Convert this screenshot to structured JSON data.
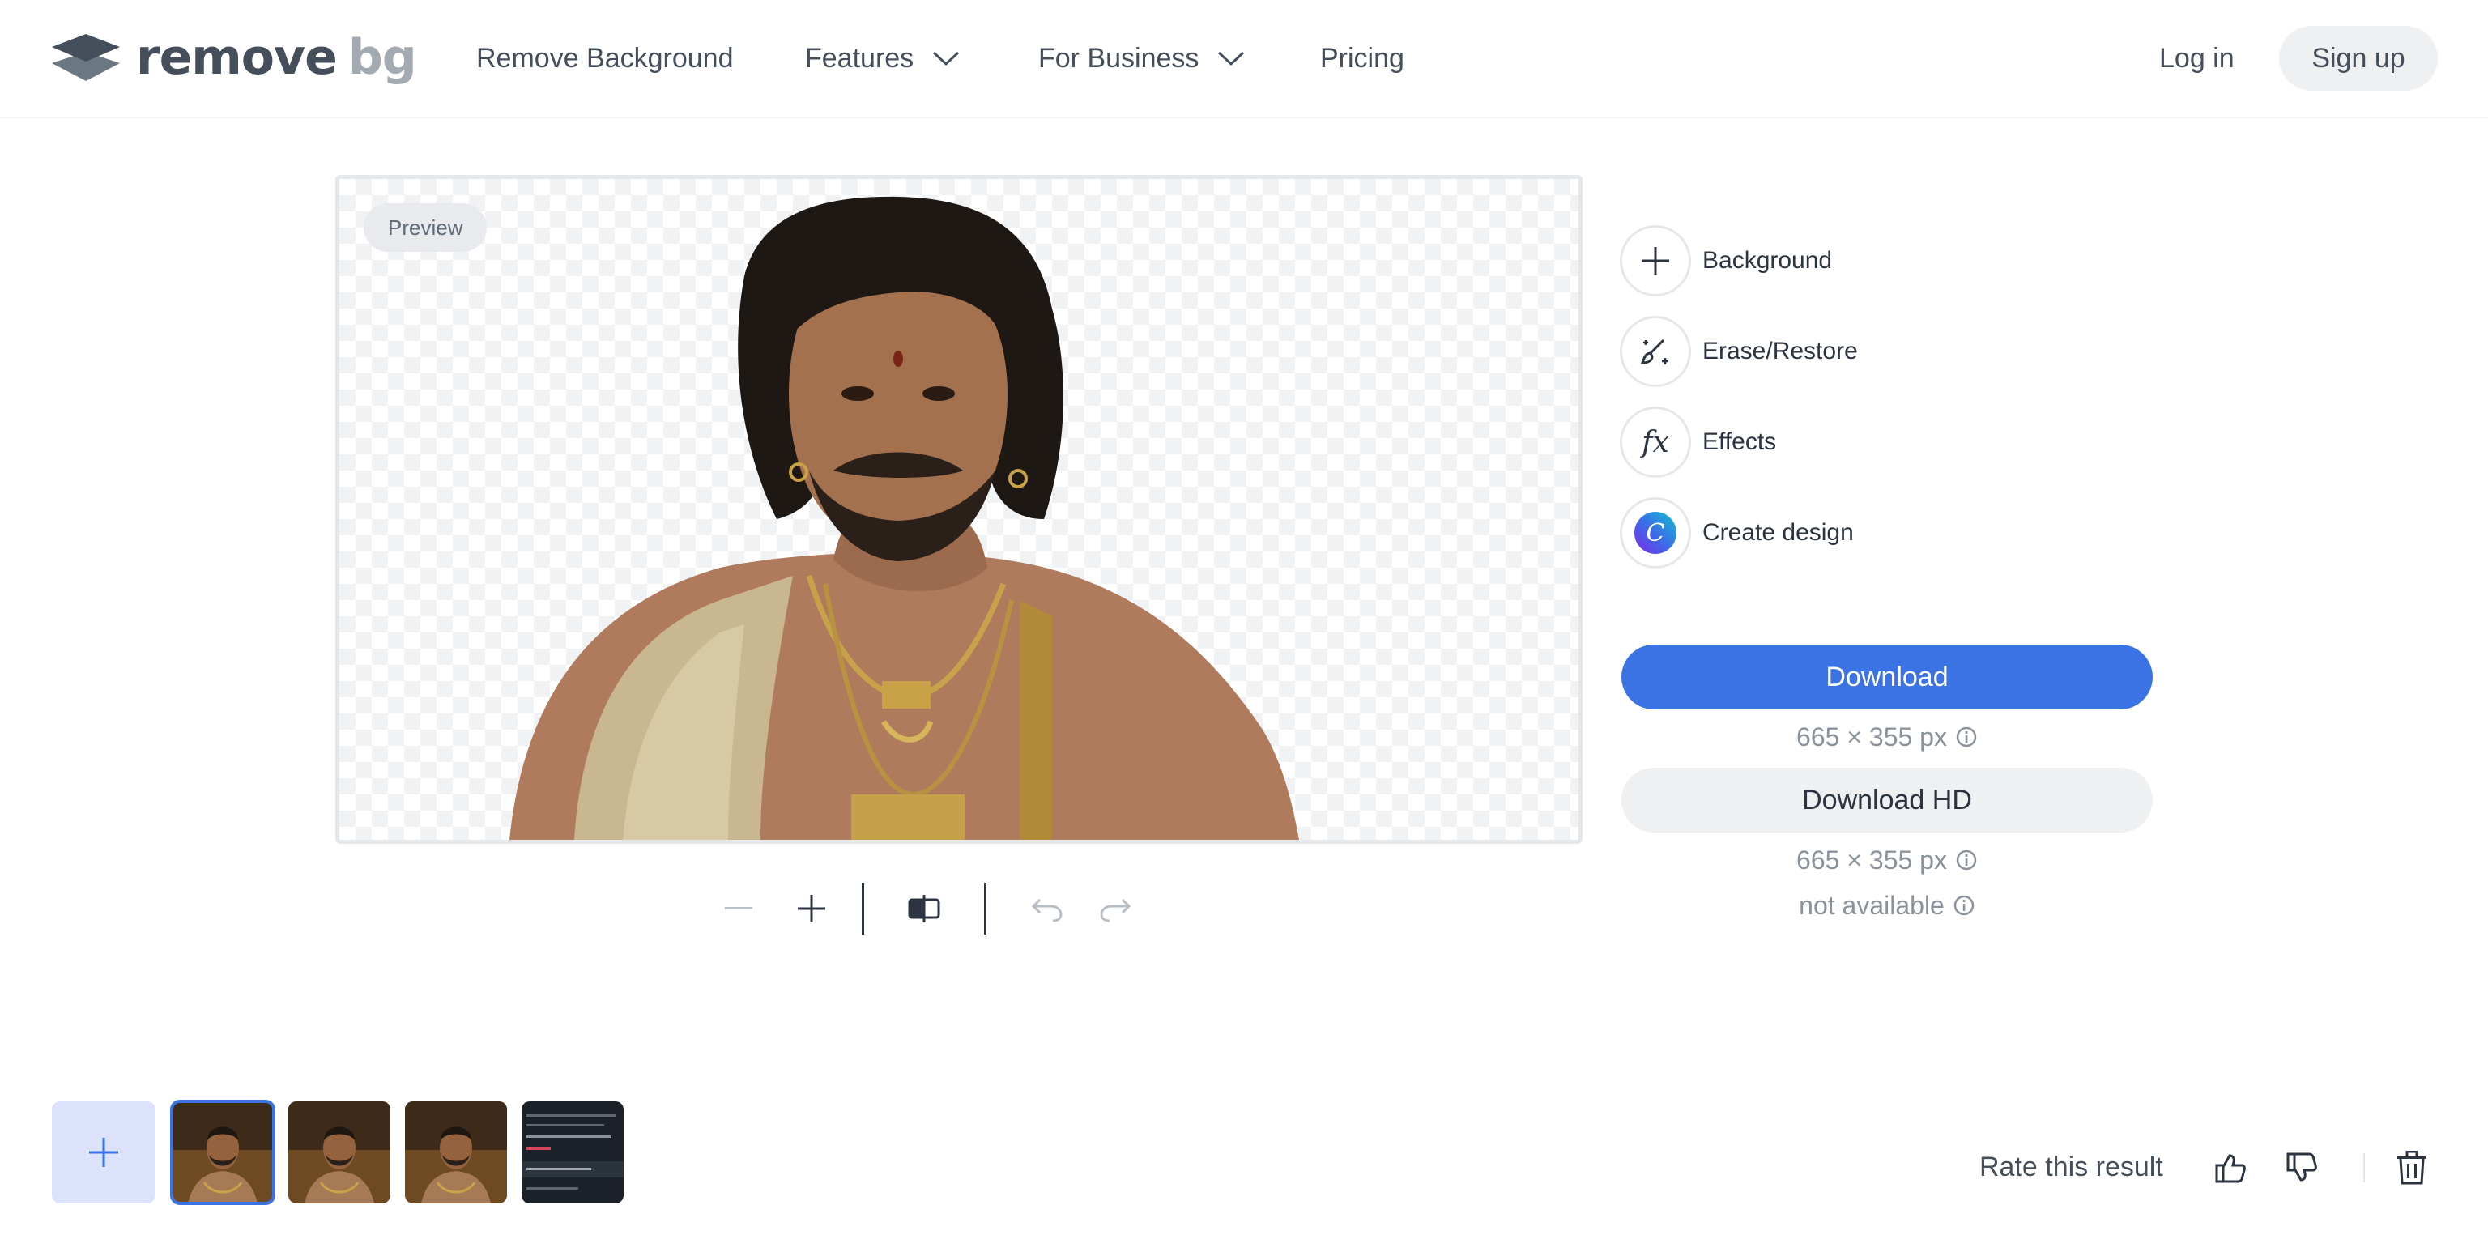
{
  "header": {
    "logo_word_1": "remove",
    "logo_word_2": "bg",
    "nav": [
      {
        "label": "Remove Background"
      },
      {
        "label": "Features"
      },
      {
        "label": "For Business"
      },
      {
        "label": "Pricing"
      }
    ],
    "login_label": "Log in",
    "signup_label": "Sign up"
  },
  "preview": {
    "badge": "Preview"
  },
  "zoom_toolbar": {
    "icons": [
      "zoom-out-icon",
      "zoom-in-icon",
      "compare-icon",
      "undo-icon",
      "redo-icon"
    ]
  },
  "tools": [
    {
      "label": "Background",
      "icon": "plus-icon"
    },
    {
      "label": "Erase/Restore",
      "icon": "magic-brush-icon"
    },
    {
      "label": "Effects",
      "icon": "fx-icon"
    },
    {
      "label": "Create design",
      "icon": "canva-icon"
    }
  ],
  "download": {
    "label": "Download",
    "size": "665 × 355 px"
  },
  "download_hd": {
    "label": "Download HD",
    "size": "665 × 355 px",
    "availability": "not available"
  },
  "footer": {
    "rate_label": "Rate this result",
    "thumbnail_count": 4
  },
  "colors": {
    "accent": "#3b73e5",
    "text": "#454f5b",
    "muted": "#8a939c",
    "chip_bg": "#eef0f2",
    "add_tile_bg": "#dde2fb"
  }
}
